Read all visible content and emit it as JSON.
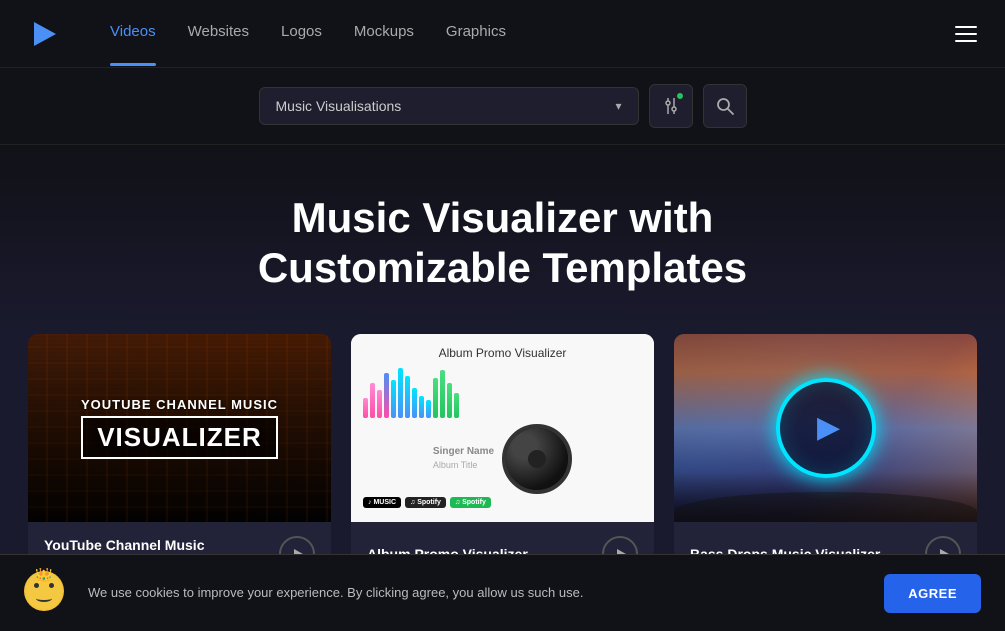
{
  "header": {
    "logo_alt": "Renderforest",
    "nav": [
      {
        "label": "Videos",
        "active": true
      },
      {
        "label": "Websites",
        "active": false
      },
      {
        "label": "Logos",
        "active": false
      },
      {
        "label": "Mockups",
        "active": false
      },
      {
        "label": "Graphics",
        "active": false
      }
    ]
  },
  "search": {
    "dropdown_value": "Music Visualisations",
    "dropdown_placeholder": "Music Visualisations",
    "filter_icon": "filter-icon",
    "search_icon": "search-icon"
  },
  "hero": {
    "title": "Music Visualizer with Customizable Templates"
  },
  "cards": [
    {
      "id": "card-1",
      "title": "YouTube Channel Music Visualizer",
      "line1": "YOUTUBE CHANNEL MUSIC",
      "line2": "VISUALIZER"
    },
    {
      "id": "card-2",
      "title": "Album Promo Visualizer",
      "thumb_title": "Album Promo Visualizer"
    },
    {
      "id": "card-3",
      "title": "Bass Drops Music Visualizer"
    }
  ],
  "cookie": {
    "text": "We use cookies to improve your experience. By clicking agree, you allow us such use.",
    "agree_label": "AGREE"
  }
}
